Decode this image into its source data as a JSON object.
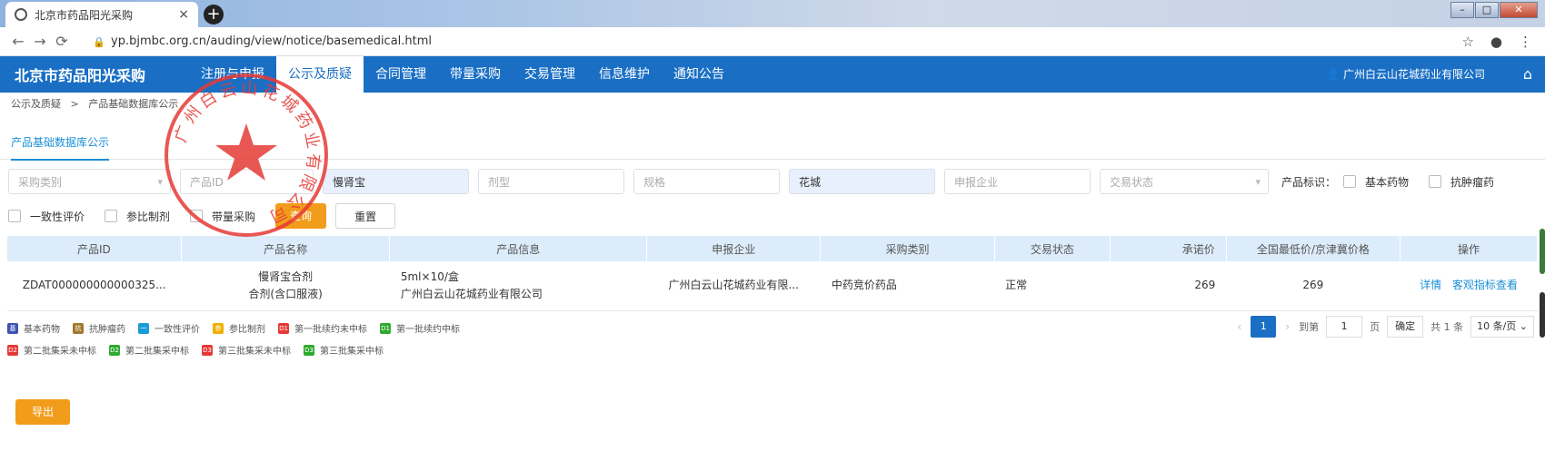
{
  "browser": {
    "tab_title": "北京市药品阳光采购",
    "url": "yp.bjmbc.org.cn/auding/view/notice/basemedical.html"
  },
  "header": {
    "brand": "北京市药品阳光采购",
    "menu": [
      "注册与申报",
      "公示及质疑",
      "合同管理",
      "带量采购",
      "交易管理",
      "信息维护",
      "通知公告"
    ],
    "active_menu": "公示及质疑",
    "user": "广州白云山花城药业有限公司"
  },
  "breadcrumb": [
    "公示及质疑",
    "产品基础数据库公示"
  ],
  "subtab": "产品基础数据库公示",
  "filters": {
    "purchase_type_placeholder": "采购类别",
    "product_id_placeholder": "产品ID",
    "product_name_value": "慢肾宝",
    "dosage_placeholder": "剂型",
    "spec_placeholder": "规格",
    "company_value": "花城",
    "reporter_placeholder": "申报企业",
    "trade_status_placeholder": "交易状态",
    "flag_label": "产品标识：",
    "checkboxes": [
      "基本药物",
      "抗肿瘤药",
      "一致性评价",
      "参比制剂",
      "带量采购"
    ],
    "query_button": "查询",
    "reset_button": "重置"
  },
  "table": {
    "columns": [
      "产品ID",
      "产品名称",
      "产品信息",
      "申报企业",
      "采购类别",
      "交易状态",
      "承诺价",
      "全国最低价/京津冀价格",
      "操作"
    ],
    "rows": [
      {
        "id": "ZDAT000000000000325...",
        "name_line1": "慢肾宝合剂",
        "name_line2": "合剂(含口服液)",
        "info_line1": "5ml×10/盒",
        "info_line2": "广州白云山花城药业有限公司",
        "company": "广州白云山花城药业有限...",
        "category": "中药竞价药品",
        "status": "正常",
        "price": "269",
        "lowest_price": "269",
        "op_detail": "详情",
        "op_indicator": "客观指标查看"
      }
    ]
  },
  "legend": {
    "row1": [
      {
        "glyph": "基",
        "label": "基本药物",
        "color": "#3f51b5"
      },
      {
        "glyph": "抗",
        "label": "抗肿瘤药",
        "color": "#a0772b"
      },
      {
        "glyph": "一",
        "label": "一致性评价",
        "color": "#1a9cd8"
      },
      {
        "glyph": "参",
        "label": "参比制剂",
        "color": "#f0b000"
      },
      {
        "glyph": "D1",
        "label": "第一批续约未中标",
        "color": "#e53935"
      },
      {
        "glyph": "D1",
        "label": "第一批续约中标",
        "color": "#2eaa2e"
      }
    ],
    "row2": [
      {
        "glyph": "D2",
        "label": "第二批集采未中标",
        "color": "#e53935"
      },
      {
        "glyph": "D2",
        "label": "第二批集采中标",
        "color": "#2eaa2e"
      },
      {
        "glyph": "D3",
        "label": "第三批集采未中标",
        "color": "#e53935"
      },
      {
        "glyph": "D3",
        "label": "第三批集采中标",
        "color": "#2eaa2e"
      }
    ]
  },
  "pagination": {
    "current": "1",
    "goto_label": "到第",
    "page_input": "1",
    "page_unit": "页",
    "confirm": "确定",
    "total": "共 1 条",
    "page_size": "10 条/页"
  },
  "export_button": "导出",
  "seal_text": "广州白云山花城药业有限公司",
  "colors": {
    "primary": "#1a6fc5",
    "accent": "#f29c1c",
    "seal": "#e53935"
  }
}
